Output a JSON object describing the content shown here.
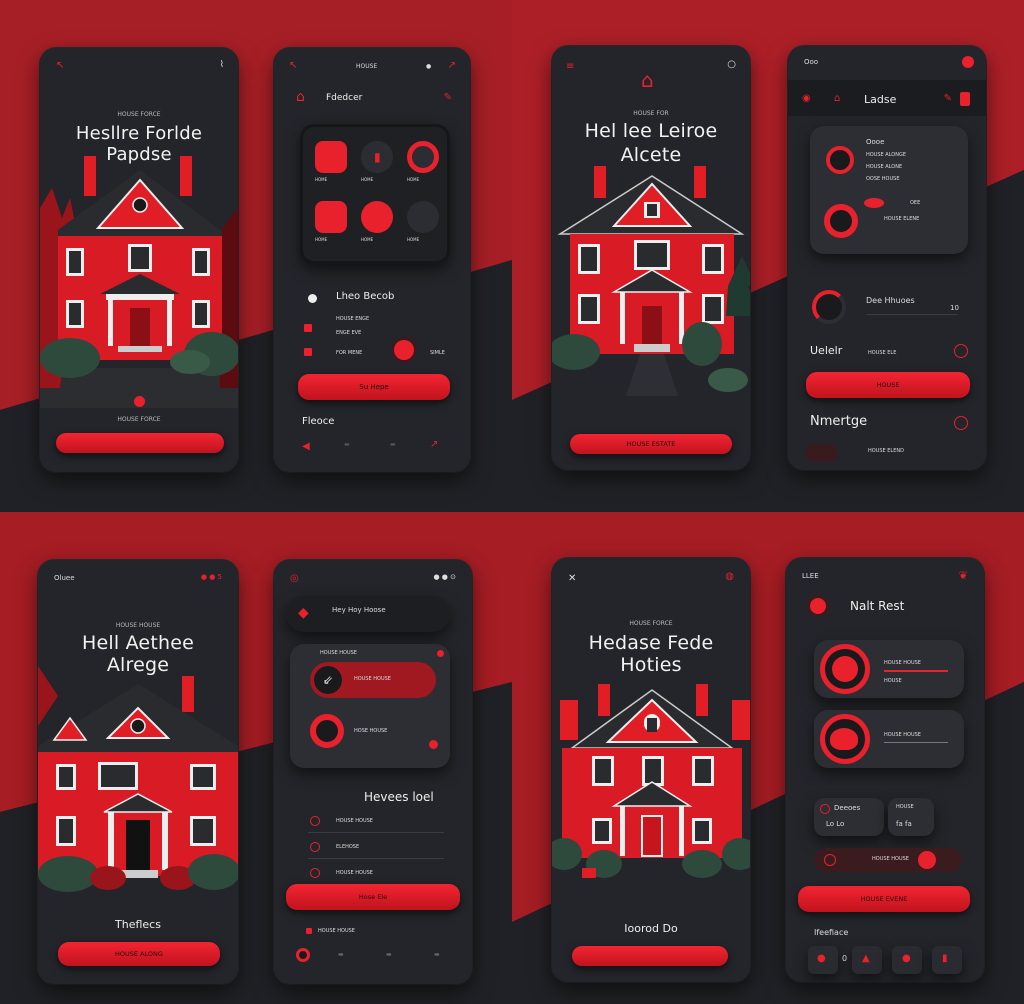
{
  "colors": {
    "accent": "#e8212d",
    "background": "#1d1e22",
    "card": "#24252a",
    "panel": "#2d2e33"
  },
  "q1": {
    "left": {
      "status_small": "HOUSE FORCE",
      "title_l1": "Hesllre Forlde",
      "title_l2": "Papdse",
      "caption": "HOUSE FORCE",
      "button": ""
    },
    "right": {
      "header_title": "Fdedcer",
      "tiles": [
        "HOME",
        "HOME",
        "HOME",
        "HOME",
        "HOME",
        "HOME"
      ],
      "row1": "Lheo Becob",
      "row2": "HOUSE ENGE",
      "row3": "ENGE EVE",
      "row4": "FOR MENE",
      "option": "SIMLE",
      "button": "Su Hepe",
      "footer": "Fleoce"
    }
  },
  "q2": {
    "left": {
      "status_small": "HOUSE FOR",
      "title_l1": "Hel lee Leiroe",
      "title_l2": "Alcete",
      "button": "HOUSE ESTATE"
    },
    "right": {
      "top": "Ooo",
      "header_title": "Ladse",
      "panel_title": "Oooe",
      "lines": [
        "HOUSE  ALONGE",
        "HOUSE  ALONE",
        "OOSE  HOUSE"
      ],
      "small1": "OEE",
      "small2": "HOUSE ELENE",
      "knob_title": "Dee Hhuoes",
      "knob_value": "10",
      "uelr": "Uelelr",
      "uelr_val": "HOUSE ELE",
      "nav": "Nmertge",
      "nav_val": "HOUSE ELEND",
      "button": "HOUSE"
    }
  },
  "q3": {
    "left": {
      "status": "Oluee",
      "title_l1": "Hell Aethee",
      "title_l2": "Alrege",
      "caption": "Theflecs",
      "button": "HOUSE ALONG"
    },
    "right": {
      "header": "Hey Hoy Hoose",
      "status": "HOUSE HOUSE",
      "pill1": "HOUSE HOUSE",
      "pill2": "HOSE HOUSE",
      "section": "Hevees loel",
      "rows": [
        "HOUSE HOUSE",
        "ELEHOSE",
        "HOUSE HOUSE"
      ],
      "button": "Hose Ele",
      "footer": "HOUSE HOUSE"
    }
  },
  "q4": {
    "left": {
      "status_small": "HOUSE FORCE",
      "title_l1": "Hedase Fede",
      "title_l2": "Hoties",
      "caption": "Ioorod Do",
      "button": ""
    },
    "right": {
      "top": "LLEE",
      "title": "Nalt Rest",
      "card1": "HOUSE HOUSE",
      "card1b": "HOUSE",
      "card2": "HOUSE HOUSE",
      "stat1": "Deeoes",
      "stat1v": "Lo  Lo",
      "stat2": "HOUSE",
      "stat2v": "fa  fa",
      "toggle": "HOUSE HOUSE",
      "button": "HOUSE EVENE",
      "footer": "Ifeefiace",
      "tab_value": "0"
    }
  }
}
